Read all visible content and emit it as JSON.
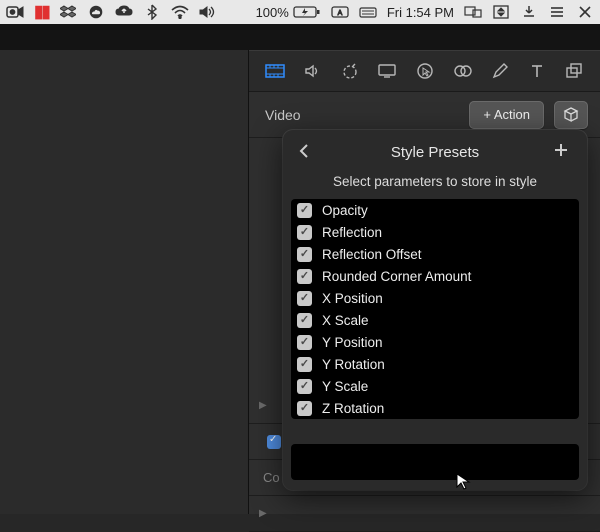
{
  "menubar": {
    "battery_pct": "100%",
    "clock": "Fri 1:54 PM"
  },
  "toolbar": {
    "icons": [
      "film",
      "audio",
      "timing",
      "display",
      "pick",
      "overlap",
      "pencil",
      "text",
      "layers"
    ]
  },
  "section": {
    "title": "Video",
    "action_label": "+ Action"
  },
  "bgrows": {
    "row2_label": "Co"
  },
  "popover": {
    "title": "Style Presets",
    "subtitle": "Select parameters to store in style",
    "params": [
      "Opacity",
      "Reflection",
      "Reflection Offset",
      "Rounded Corner Amount",
      "X Position",
      "X Scale",
      "Y Position",
      "Y Rotation",
      "Y Scale",
      "Z Rotation"
    ]
  }
}
